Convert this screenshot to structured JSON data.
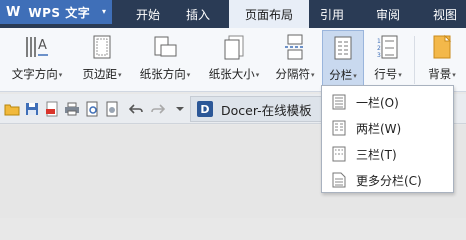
{
  "app": {
    "logo": "W",
    "title": "WPS 文字",
    "caret": "▾"
  },
  "menu": [
    "开始",
    "插入",
    "页面布局",
    "引用",
    "审阅",
    "视图"
  ],
  "ribbon": {
    "items": [
      {
        "label": "文字方向",
        "icon": "text-direction-icon"
      },
      {
        "label": "页边距",
        "icon": "margins-icon"
      },
      {
        "label": "纸张方向",
        "icon": "orientation-icon"
      },
      {
        "label": "纸张大小",
        "icon": "paper-size-icon"
      },
      {
        "label": "分隔符",
        "icon": "separator-icon"
      },
      {
        "label": "分栏",
        "icon": "columns-icon"
      },
      {
        "label": "行号",
        "icon": "line-number-icon"
      },
      {
        "label": "背景",
        "icon": "background-icon"
      }
    ],
    "dropdown_glyph": "▾"
  },
  "quickbar": {
    "doc_tab": "Docer-在线模板",
    "doc_tab_icon": "D"
  },
  "columns_menu": [
    "一栏(O)",
    "两栏(W)",
    "三栏(T)",
    "更多分栏(C)"
  ],
  "colors": {
    "titlebar": "#2a3b55",
    "app_button": "#3f6fb8",
    "ribbon_bg": "#f6f8fb",
    "selected": "#c9d9ef"
  }
}
